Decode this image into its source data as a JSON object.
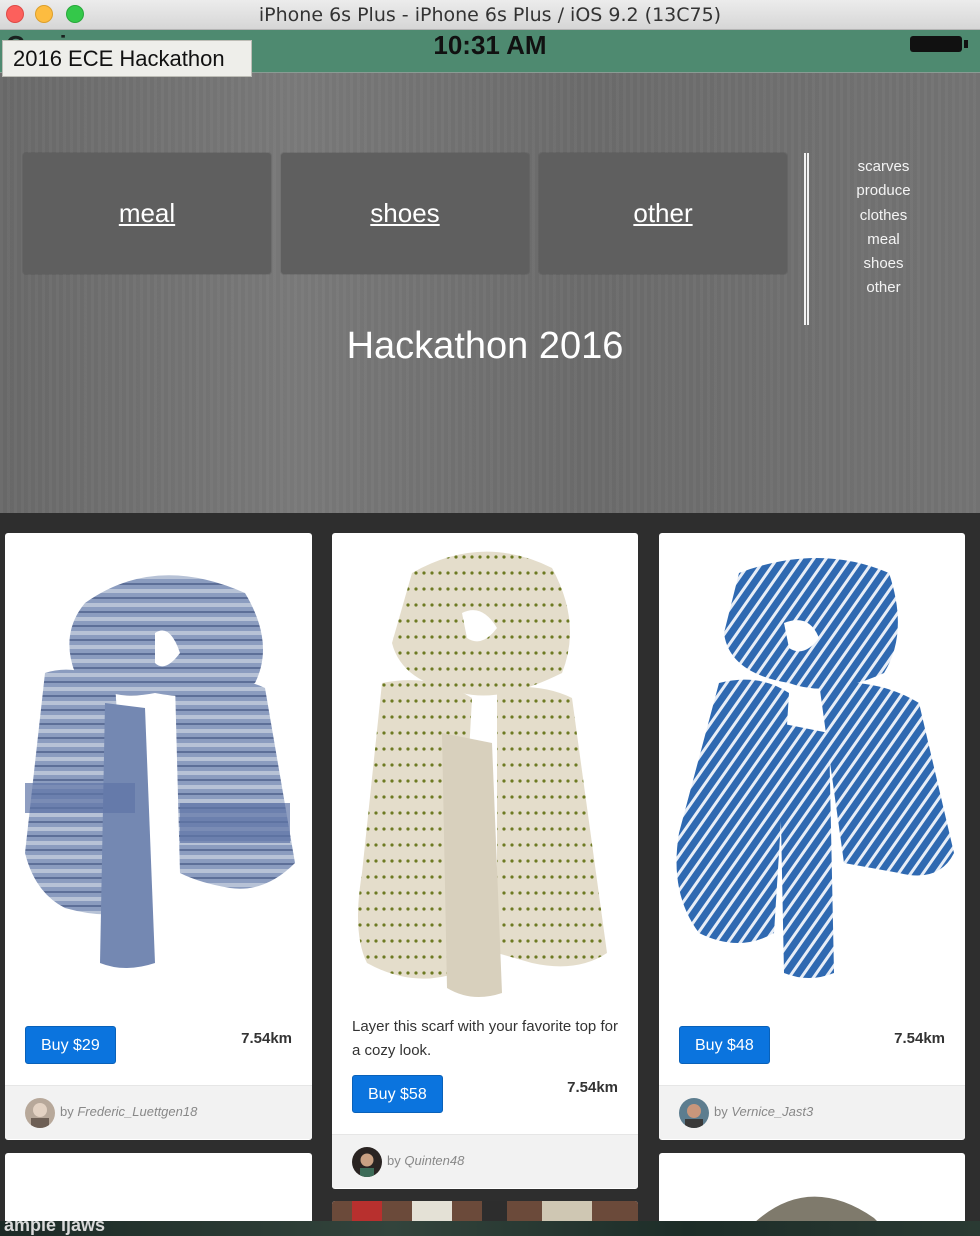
{
  "window": {
    "title": "iPhone 6s Plus - iPhone 6s Plus / iOS 9.2 (13C75)"
  },
  "status_bar": {
    "carrier": "Carrier",
    "time": "10:31 AM"
  },
  "tooltip": "2016 ECE Hackathon",
  "categories": [
    "meal",
    "shoes",
    "other"
  ],
  "side_menu": [
    "scarves",
    "produce",
    "clothes",
    "meal",
    "shoes",
    "other"
  ],
  "hero_title": "Hackathon 2016",
  "products": [
    {
      "buy_label": "Buy $29",
      "distance": "7.54km",
      "description": "",
      "by": "by",
      "seller": "Frederic_Luettgen18"
    },
    {
      "buy_label": "Buy $58",
      "distance": "7.54km",
      "description": "Layer this scarf with your favorite top for a cozy look.",
      "by": "by",
      "seller": "Quinten48"
    },
    {
      "buy_label": "Buy $48",
      "distance": "7.54km",
      "description": "",
      "by": "by",
      "seller": "Vernice_Jast3"
    }
  ],
  "bottom_overlay": "ample ijaws",
  "colors": {
    "status_bar": "#4e8a70",
    "accent_button": "#0b74de",
    "grid_background": "#2e2e2e"
  }
}
